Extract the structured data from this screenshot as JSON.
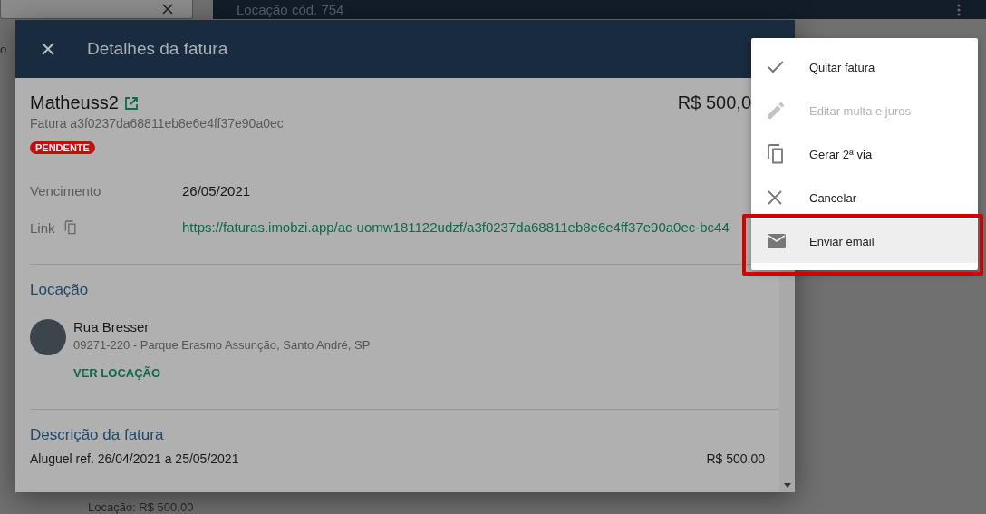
{
  "background_page": {
    "header_title": "Locação cód. 754",
    "side_text": "o",
    "footer_text": "Locação: R$ 500,00"
  },
  "dialog": {
    "title": "Detalhes da fatura",
    "name": "Matheuss2",
    "invoice_id": "Fatura a3f0237da68811eb8e6e4ff37e90a0ec",
    "amount": "R$ 500,0",
    "status": {
      "label": "PENDENTE",
      "kind": "pending"
    },
    "fields": [
      {
        "label": "Vencimento",
        "value": "26/05/2021",
        "kind": "text"
      },
      {
        "label": "Link",
        "value": "https://faturas.imobzi.app/ac-uomw181122udzf/a3f0237da68811eb8e6e4ff37e90a0ec-bc44",
        "kind": "link"
      }
    ],
    "location": {
      "heading": "Locação",
      "street": "Rua Bresser",
      "address": "09271-220 - Parque Erasmo Assunção, Santo André, SP",
      "action": "VER LOCAÇÃO"
    },
    "description": {
      "heading": "Descrição da fatura",
      "items": [
        {
          "label": "Aluguel ref. 26/04/2021 a 25/05/2021",
          "amount": "R$ 500,00"
        }
      ]
    }
  },
  "menu": {
    "items": [
      {
        "label": "Quitar fatura",
        "kind": "check",
        "disabled": false,
        "selected": false
      },
      {
        "label": "Editar multa e juros",
        "kind": "pencil",
        "disabled": true,
        "selected": false
      },
      {
        "label": "Gerar 2ª via",
        "kind": "copy",
        "disabled": false,
        "selected": false
      },
      {
        "label": "Cancelar",
        "kind": "close",
        "disabled": false,
        "selected": false
      },
      {
        "label": "Enviar email",
        "kind": "mail",
        "disabled": false,
        "selected": true
      }
    ]
  }
}
